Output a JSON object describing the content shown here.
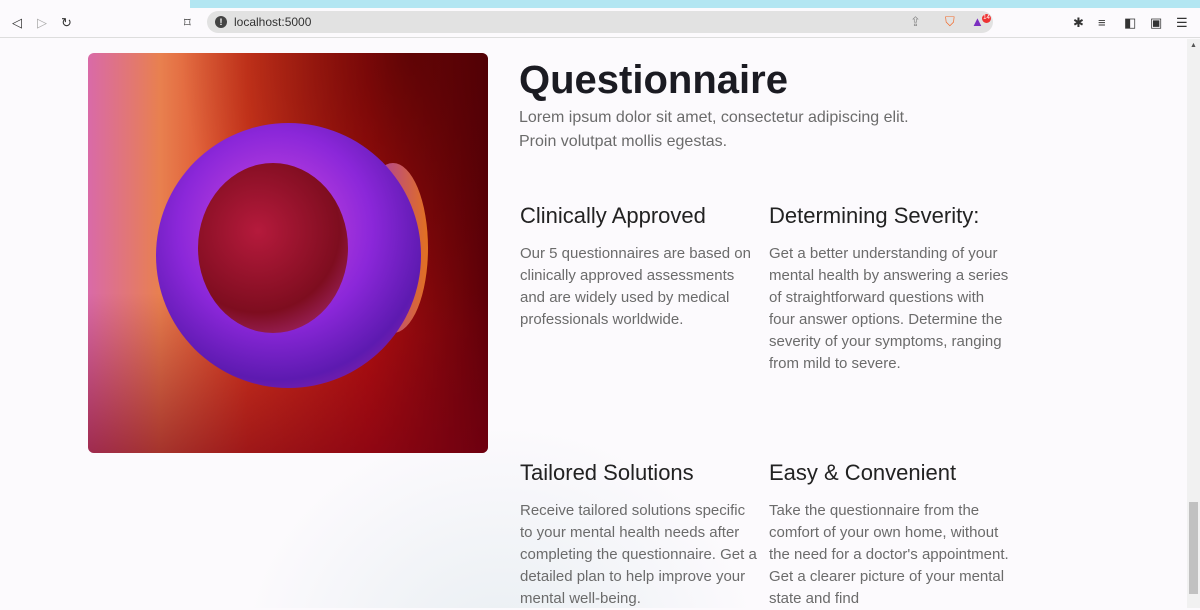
{
  "browser": {
    "url": "localhost:5000",
    "ext_badge": "14"
  },
  "main": {
    "title": "Questionnaire",
    "subtitle": "Lorem ipsum dolor sit amet, consectetur adipiscing elit. Proin volutpat mollis egestas.",
    "features": [
      {
        "title": "Clinically Approved",
        "text": "Our 5 questionnaires are based on clinically approved assessments and are widely used by medical professionals worldwide."
      },
      {
        "title": "Determining Severity:",
        "text": "Get a better understanding of your mental health by answering a series of straightforward questions with four answer options. Determine the severity of your symptoms, ranging from mild to severe."
      },
      {
        "title": "Tailored Solutions",
        "text": "Receive tailored solutions specific to your mental health needs after completing the questionnaire. Get a detailed plan to help improve your mental well-being."
      },
      {
        "title": "Easy & Convenient",
        "text": "Take the questionnaire from the comfort of your own home, without the need for a doctor's appointment. Get a clearer picture of your mental state and find"
      }
    ]
  }
}
